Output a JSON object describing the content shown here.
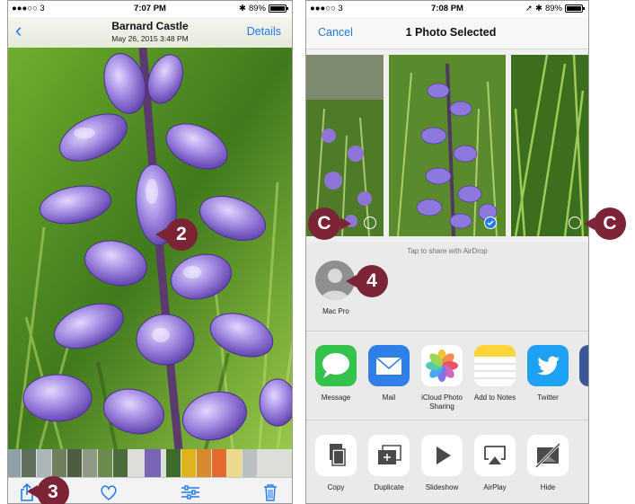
{
  "left_phone": {
    "status": {
      "carrier": "●●●○○ 3",
      "time": "7:07 PM",
      "battery": "89%",
      "battery_level": 0.89
    },
    "nav": {
      "back_label": "‹",
      "title": "Barnard Castle",
      "subtitle": "May 26, 2015  3:48 PM",
      "details_label": "Details"
    },
    "toolbar": {
      "share_icon": "share-icon",
      "favorite_icon": "heart-icon",
      "edit_icon": "adjust-sliders-icon",
      "delete_icon": "trash-icon"
    }
  },
  "right_phone": {
    "status": {
      "carrier": "●●●○○ 3",
      "time": "7:08 PM",
      "battery": "89%",
      "battery_level": 0.89
    },
    "nav": {
      "cancel_label": "Cancel",
      "title": "1 Photo Selected"
    },
    "airdrop": {
      "hint": "Tap to share with AirDrop",
      "device_label": "Mac Pro"
    },
    "apps": [
      {
        "label": "Message",
        "icon": "messages-icon",
        "color": "#34c24a"
      },
      {
        "label": "Mail",
        "icon": "mail-icon",
        "color": "#2f7fe6"
      },
      {
        "label": "iCloud Photo Sharing",
        "icon": "photos-icon",
        "color": "#ffffff"
      },
      {
        "label": "Add to Notes",
        "icon": "notes-icon",
        "color": "#ffd43b"
      },
      {
        "label": "Twitter",
        "icon": "twitter-icon",
        "color": "#1da1f2"
      }
    ],
    "actions": [
      {
        "label": "Copy",
        "icon": "copy-icon"
      },
      {
        "label": "Duplicate",
        "icon": "duplicate-icon"
      },
      {
        "label": "Slideshow",
        "icon": "play-icon"
      },
      {
        "label": "AirPlay",
        "icon": "airplay-icon"
      },
      {
        "label": "Hide",
        "icon": "hide-icon"
      }
    ]
  },
  "callouts": {
    "step2": "2",
    "step3": "3",
    "step4": "4",
    "stepC_left": "C",
    "stepC_right": "C"
  },
  "colors": {
    "ios_blue": "#1e7bf0",
    "callout": "#7b2436",
    "bluebell": "#8a6fc9"
  }
}
